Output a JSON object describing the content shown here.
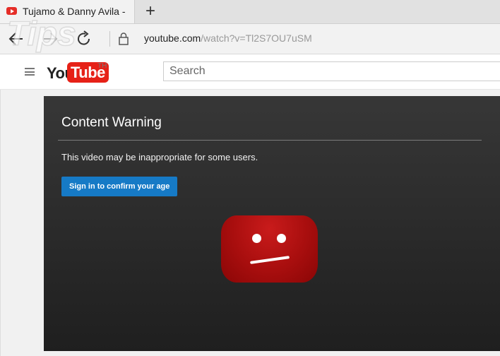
{
  "browser": {
    "tab_title": "Tujamo & Danny Avila -",
    "new_tab_symbol": "+",
    "url_host": "youtube.com",
    "url_path": "/watch?v=Tl2S7OU7uSM"
  },
  "youtube": {
    "logo_you": "You",
    "logo_tube": "Tube",
    "logo_region": "TH",
    "search_placeholder": "Search"
  },
  "warning": {
    "title": "Content Warning",
    "message": "This video may be inappropriate for some users.",
    "signin_button": "Sign in to confirm your age"
  },
  "watermark": {
    "text": "Tips"
  },
  "colors": {
    "youtube_red": "#e62117",
    "signin_blue": "#167ac6",
    "player_bg": "#2b2b2b"
  }
}
